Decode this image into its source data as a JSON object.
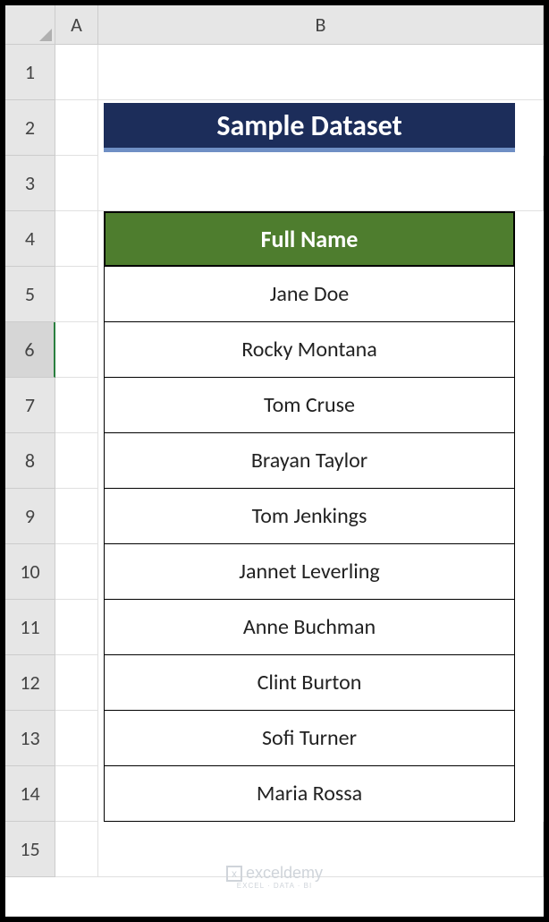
{
  "columns": {
    "A": "A",
    "B": "B"
  },
  "rows": [
    "1",
    "2",
    "3",
    "4",
    "5",
    "6",
    "7",
    "8",
    "9",
    "10",
    "11",
    "12",
    "13",
    "14",
    "15"
  ],
  "selectedRow": 6,
  "title": "Sample Dataset",
  "tableHeader": "Full Name",
  "tableData": [
    "Jane Doe",
    "Rocky Montana",
    "Tom Cruse",
    "Brayan Taylor",
    "Tom Jenkings",
    "Jannet Leverling",
    "Anne Buchman",
    "Clint Burton",
    "Sofi Turner",
    "Maria Rossa"
  ],
  "watermark": {
    "brand": "exceldemy",
    "tagline": "EXCEL · DATA · BI"
  },
  "colors": {
    "titleBg": "#1c2d5a",
    "titleUnderline": "#6f8fc4",
    "headerBg": "#4e7d2e",
    "cellBorder": "#000000"
  }
}
